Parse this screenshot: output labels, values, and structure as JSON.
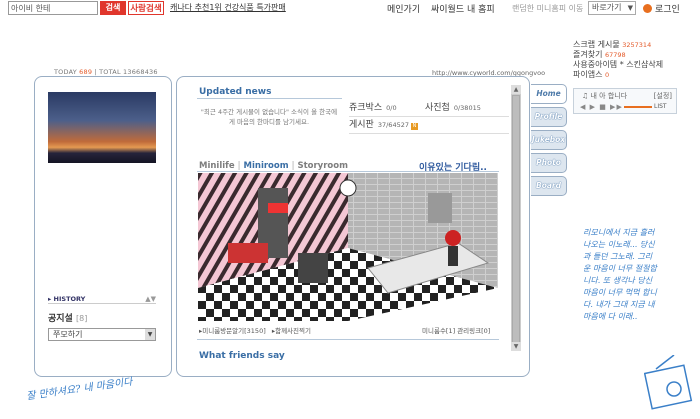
{
  "topbar": {
    "search_placeholder": "아이비 한테",
    "search_button": "검색",
    "people_search": "사람검색",
    "promo": "캐나다 추천1위 건강식품 특가판매",
    "nav": [
      "메인가기",
      "싸이월드 내 홈피"
    ],
    "random": "랜덤한 미니홈피 이동",
    "shortcut": "바로가기",
    "login": "로그인"
  },
  "counters": {
    "today_label": "TODAY",
    "today": "689",
    "total_label": "TOTAL",
    "total": "13668436",
    "url": "http://www.cyworld.com/ggongvoo"
  },
  "left": {
    "history": "HISTORY",
    "notice_title": "공지설",
    "notice_count": "[8]",
    "follow_select": "쭈모하기"
  },
  "main": {
    "updated_news": "Updated news",
    "news_message": "\"최근 4주간 게시물이 없습니다\" 소식이 올 한국에게 마음의 한마디를 남기세요.",
    "stats": [
      {
        "label": "쥬크박스",
        "count": "0/0",
        "label2": "사진첩",
        "count2": "0/38015"
      },
      {
        "label": "게시판",
        "count": "37/64527"
      }
    ],
    "tabs": [
      "Minilife",
      "Miniroom",
      "Storyroom"
    ],
    "room_title": "이유있는 기다림..",
    "room_link_left": "미니룸방문알기[3150]",
    "room_link_mid": "함께사진찍기",
    "room_link_right": "미니룸수[1]  관리링크[0]",
    "friends_title": "What friends say"
  },
  "side_tabs": [
    "Home",
    "Profile",
    "Jukebox",
    "Photo",
    "Board"
  ],
  "right": {
    "lines": [
      {
        "label": "스크랩 게시물",
        "value": "3257314"
      },
      {
        "label": "즐겨찾기",
        "value": "67798"
      },
      {
        "label": "사용중아이템 *",
        "value": "스킨샵삭제"
      },
      {
        "label": "파이앱스",
        "value": "0"
      }
    ],
    "player_title": "내 아 합니다",
    "player_setting": "[설정]",
    "handwrite": "리모니에서 지금 흘러나오는 이노래... 당신과 들던 그노래. 그리운 마음이 너무 절절합니다. 또 생각나 당신 마음이 너무 먹먹 합니다. 내가 그대 지금 내 마음에 다 이래..",
    "handwrite_left": "잘 만하셔요? 내 마음이다"
  },
  "colors": {
    "accent": "#3a6ea5",
    "search": "#e0362c",
    "frame": "#9aaec4",
    "counter": "#e45b2b"
  }
}
